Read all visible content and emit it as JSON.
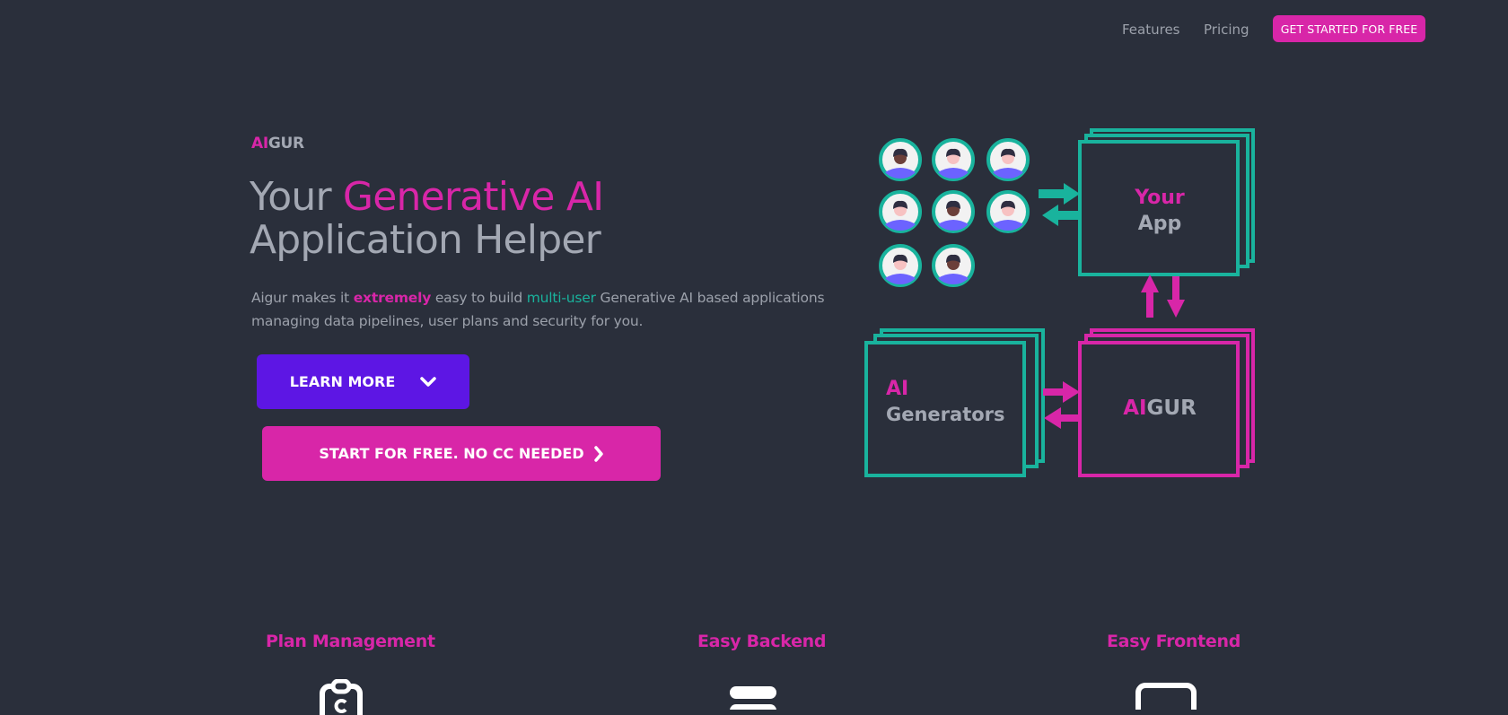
{
  "nav": {
    "links": [
      {
        "label": "Features"
      },
      {
        "label": "Pricing"
      }
    ],
    "cta_label": "GET STARTED FOR FREE"
  },
  "hero": {
    "brand": {
      "highlight": "AI",
      "rest": "GUR"
    },
    "headline": {
      "part1": "Your ",
      "highlight": "Generative AI",
      "part2": "Application Helper"
    },
    "description": {
      "t1": "Aigur makes it ",
      "strong": "extremely",
      "t2": " easy to build ",
      "teal": "multi-user",
      "t3": " Generative AI based applications managing data pipelines, user plans and security for you."
    },
    "learn_more_label": "LEARN MORE",
    "start_free_label": "START FOR FREE. NO CC NEEDED"
  },
  "diagram": {
    "users_count": 8,
    "your_app": {
      "line1": "Your",
      "line2": "App"
    },
    "ai_generators": {
      "line1": "AI",
      "line2": "Generators"
    },
    "aigur": {
      "highlight": "AI",
      "rest": "GUR"
    }
  },
  "features": [
    {
      "title": "Plan Management",
      "icon": "clipboard-icon"
    },
    {
      "title": "Easy Backend",
      "icon": "server-icon"
    },
    {
      "title": "Easy Frontend",
      "icon": "window-icon"
    }
  ],
  "colors": {
    "background": "#2a2f3b",
    "pink": "#d826a8",
    "purple": "#5d16e4",
    "teal": "#19b39d",
    "text": "#a3a8b3"
  }
}
